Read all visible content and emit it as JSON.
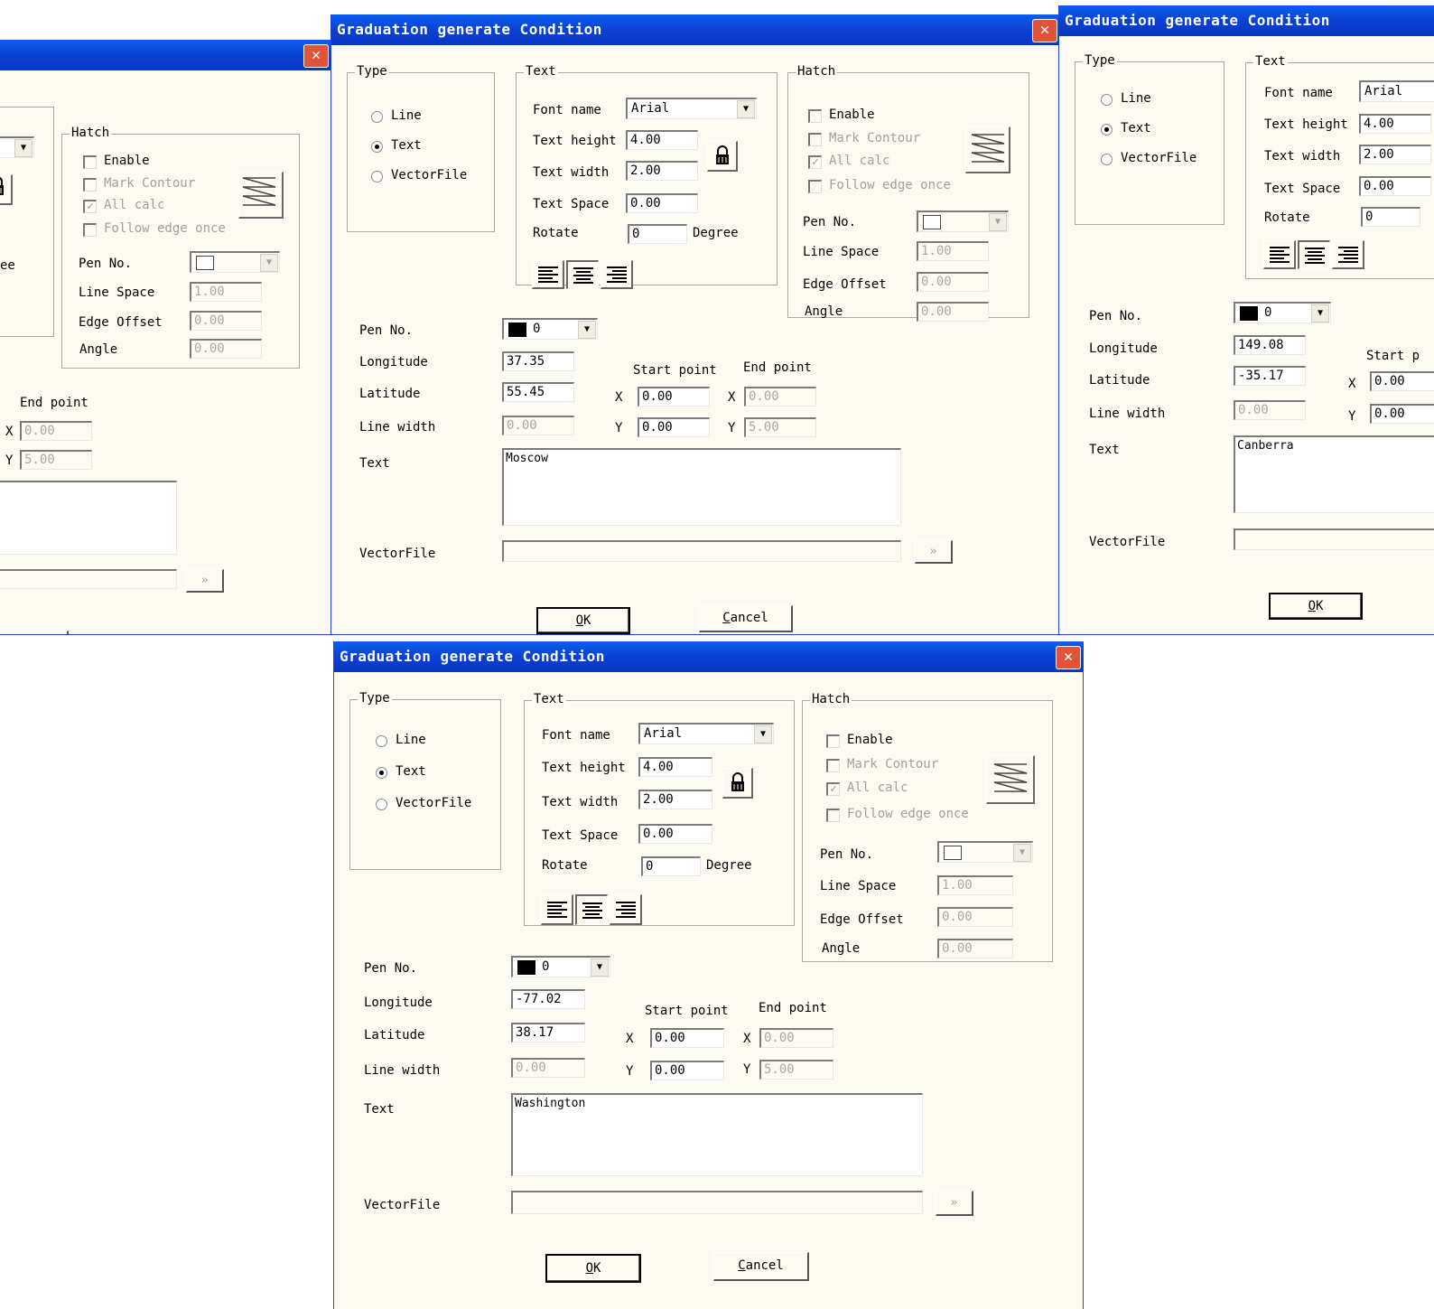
{
  "dialog": {
    "title": "Graduation generate Condition",
    "close_symbol": "✕",
    "type_group": {
      "legend": "Type",
      "options": [
        "Line",
        "Text",
        "VectorFile"
      ]
    },
    "text_group": {
      "legend": "Text",
      "font_name_label": "Font name",
      "text_height_label": "Text height",
      "text_width_label": "Text width",
      "text_space_label": "Text Space",
      "rotate_label": "Rotate",
      "degree_label": "Degree"
    },
    "hatch_group": {
      "legend": "Hatch",
      "enable_label": "Enable",
      "mark_contour_label": "Mark Contour",
      "all_calc_label": "All calc",
      "follow_edge_label": "Follow edge once",
      "pen_no_label": "Pen No.",
      "line_space_label": "Line Space",
      "edge_offset_label": "Edge Offset",
      "angle_label": "Angle",
      "line_space_value": "1.00",
      "edge_offset_value": "0.00",
      "angle_value": "0.00"
    },
    "labels": {
      "pen_no": "Pen No.",
      "longitude": "Longitude",
      "latitude": "Latitude",
      "line_width": "Line width",
      "text": "Text",
      "vectorfile": "VectorFile",
      "start_point": "Start point",
      "end_point": "End point",
      "x": "X",
      "y": "Y",
      "more": "»"
    },
    "buttons": {
      "ok_u": "O",
      "ok_rest": "K",
      "cancel_u": "C",
      "cancel_rest": "ancel"
    }
  },
  "instances": {
    "left": {
      "hatch_pen": "",
      "end_x": "0.00",
      "end_y": "5.00",
      "partial_label": "ee"
    },
    "moscow": {
      "font_name": "Arial",
      "text_height": "4.00",
      "text_width": "2.00",
      "text_space": "0.00",
      "rotate": "0",
      "pen_no": "0",
      "longitude": "37.35",
      "latitude": "55.45",
      "line_width": "0.00",
      "start_x": "0.00",
      "start_y": "0.00",
      "end_x": "0.00",
      "end_y": "5.00",
      "text": "Moscow"
    },
    "canberra": {
      "font_name": "Arial",
      "text_height": "4.00",
      "text_width": "2.00",
      "text_space": "0.00",
      "rotate": "0",
      "pen_no": "0",
      "longitude": "149.08",
      "latitude": "-35.17",
      "line_width": "0.00",
      "start_label_partial": "Start p",
      "start_x": "0.00",
      "start_y": "0.00",
      "text": "Canberra"
    },
    "washington": {
      "font_name": "Arial",
      "text_height": "4.00",
      "text_width": "2.00",
      "text_space": "0.00",
      "rotate": "0",
      "pen_no": "0",
      "longitude": "-77.02",
      "latitude": "38.17",
      "line_width": "0.00",
      "start_x": "0.00",
      "start_y": "0.00",
      "end_x": "0.00",
      "end_y": "5.00",
      "text": "Washington"
    }
  },
  "colors": {
    "titlebar": "#0a4ee0",
    "dialog_bg": "#fdfbf1",
    "close": "#e0553a"
  }
}
